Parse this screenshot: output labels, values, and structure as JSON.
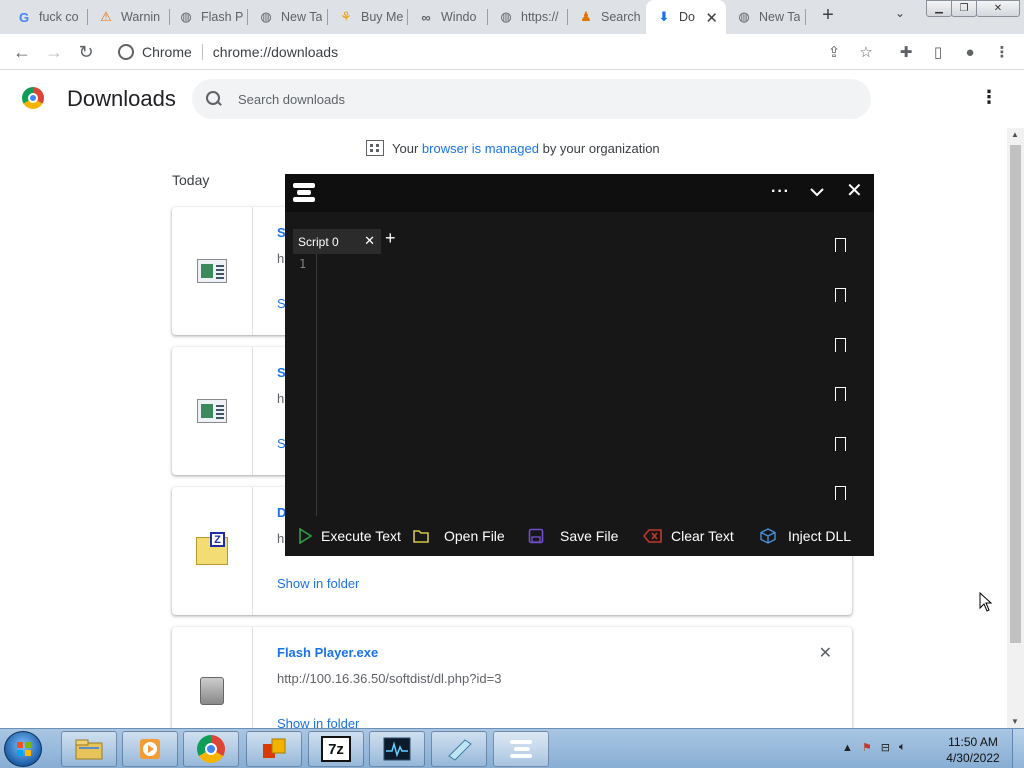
{
  "tabs": [
    {
      "title": "fuck co",
      "icon": "google-g-icon"
    },
    {
      "title": "Warnin",
      "icon": "warning-site-icon"
    },
    {
      "title": "Flash P",
      "icon": "globe-icon"
    },
    {
      "title": "New Ta",
      "icon": "globe-icon"
    },
    {
      "title": "Buy Me",
      "icon": "shop-icon"
    },
    {
      "title": "Windo",
      "icon": "link-icon"
    },
    {
      "title": "https://",
      "icon": "globe-icon"
    },
    {
      "title": "Search",
      "icon": "person-icon"
    },
    {
      "title": "Do",
      "icon": "download-icon",
      "active": true
    },
    {
      "title": "New Ta",
      "icon": "globe-icon"
    }
  ],
  "toolbar": {
    "site_label": "Chrome",
    "url": "chrome://downloads"
  },
  "downloads": {
    "title": "Downloads",
    "search_placeholder": "Search downloads",
    "managed_prefix": "Your",
    "managed_link": "browser is managed",
    "managed_suffix": "by your organization",
    "section_today": "Today",
    "items": [
      {
        "name": "S",
        "url": "h",
        "show": "S",
        "icon": "document-file-icon"
      },
      {
        "name": "S",
        "url": "h",
        "show": "S",
        "icon": "document-file-icon"
      },
      {
        "name": "D",
        "url": "h",
        "show": "Show in folder",
        "icon": "7z-archive-icon"
      },
      {
        "name": "Flash Player.exe",
        "url": "http://100.16.36.50/softdist/dl.php?id=3",
        "show": "Show in folder",
        "icon": "installer-exe-icon"
      }
    ]
  },
  "executor": {
    "tab_label": "Script 0",
    "line_number": "1",
    "actions": {
      "execute": "Execute Text",
      "open": "Open File",
      "save": "Save File",
      "clear": "Clear Text",
      "inject": "Inject DLL"
    },
    "colors": {
      "execute": "#2ea043",
      "open": "#d4c341",
      "save": "#6f4fc9",
      "clear": "#c0392b",
      "inject": "#4a90d9"
    }
  },
  "taskbar": {
    "time": "11:50 AM",
    "date": "4/30/2022"
  }
}
